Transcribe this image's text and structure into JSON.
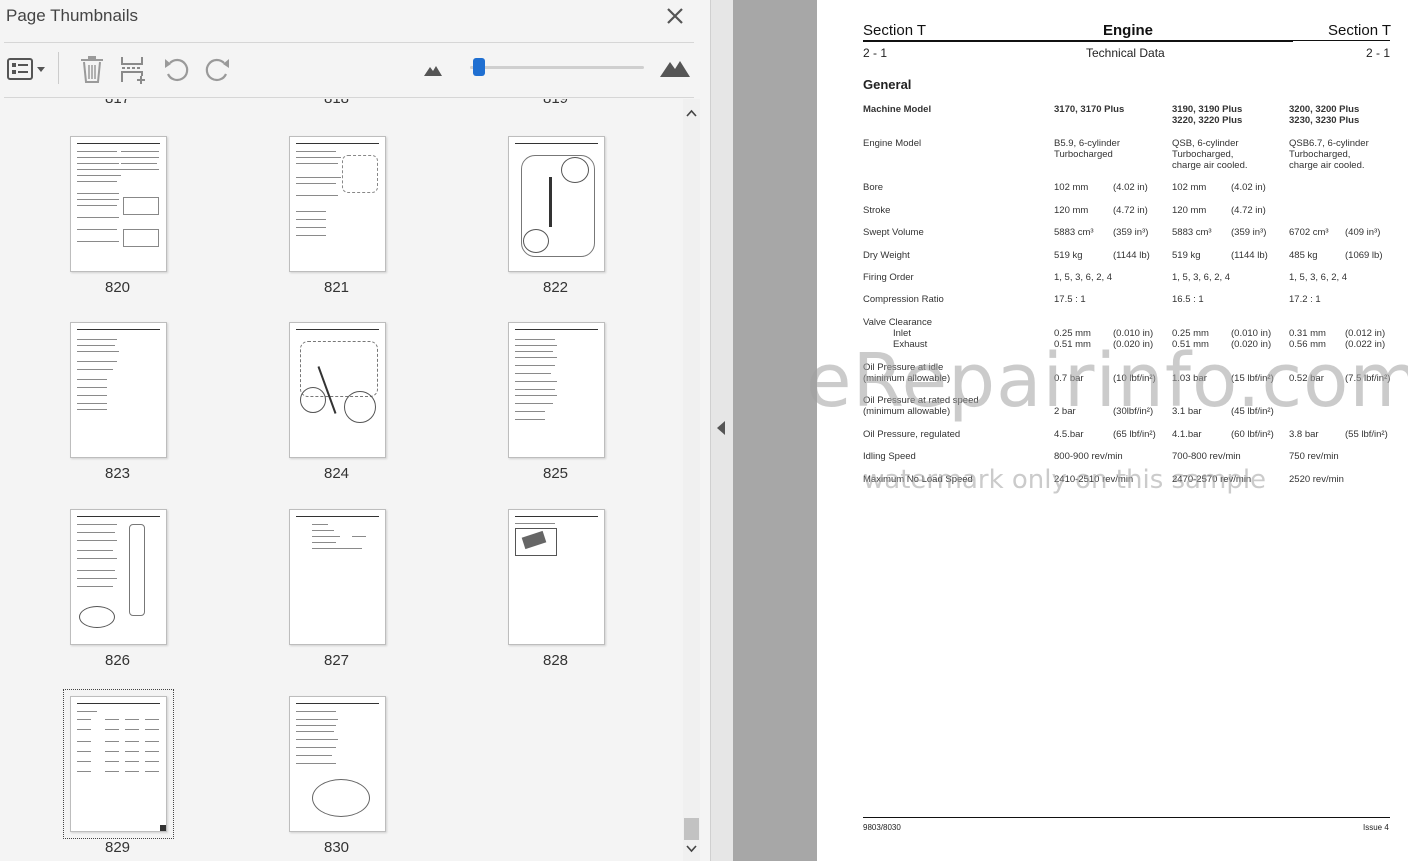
{
  "panel": {
    "title": "Page Thumbnails",
    "close_icon": "close-icon",
    "toolbar": {
      "options_icon": "thumbnail-options-icon",
      "delete_icon": "trash-icon",
      "insert_icon": "insert-pages-icon",
      "rotate_ccw_icon": "rotate-counterclockwise-icon",
      "rotate_cw_icon": "rotate-clockwise-icon",
      "zoom_out_icon": "small-mountain-icon",
      "zoom_in_icon": "large-mountain-icon",
      "zoom_level_fraction": 0.02
    }
  },
  "thumbnails": {
    "partial_numbers": [
      "817",
      "818",
      "819"
    ],
    "pages": [
      "820",
      "821",
      "822",
      "823",
      "824",
      "825",
      "826",
      "827",
      "828",
      "829",
      "830"
    ],
    "selected": "829"
  },
  "document": {
    "header": {
      "left": "Section T",
      "center": "Engine",
      "right": "Section T",
      "left_sub": "2 - 1",
      "center_sub": "Technical Data",
      "right_sub": "2 - 1"
    },
    "section_title": "General",
    "columns": {
      "label": "Machine Model",
      "c1": "3170, 3170 Plus",
      "c2a": "3190, 3190 Plus",
      "c2b": "3220, 3220 Plus",
      "c3a": "3200, 3200 Plus",
      "c3b": "3230, 3230 Plus"
    },
    "engine_model": {
      "label": "Engine Model",
      "c1a": "B5.9, 6-cylinder",
      "c1b": "Turbocharged",
      "c2a": "QSB, 6-cylinder",
      "c2b": "Turbocharged,",
      "c2c": "charge air cooled.",
      "c3a": "QSB6.7, 6-cylinder",
      "c3b": "Turbocharged,",
      "c3c": "charge air cooled."
    },
    "rows": [
      {
        "label": "Bore",
        "v1": "102 mm",
        "u1": "(4.02 in)",
        "v2": "102 mm",
        "u2": "(4.02 in)",
        "v3": "",
        "u3": ""
      },
      {
        "label": "Stroke",
        "v1": "120 mm",
        "u1": "(4.72 in)",
        "v2": "120 mm",
        "u2": "(4.72 in)",
        "v3": "",
        "u3": ""
      },
      {
        "label": "Swept Volume",
        "v1": "5883 cm³",
        "u1": "(359 in³)",
        "v2": "5883 cm³",
        "u2": "(359 in³)",
        "v3": "6702 cm³",
        "u3": "(409 in³)"
      },
      {
        "label": "Dry Weight",
        "v1": "519 kg",
        "u1": "(1144 lb)",
        "v2": "519 kg",
        "u2": "(1144 lb)",
        "v3": "485 kg",
        "u3": "(1069 lb)"
      },
      {
        "label": "Firing Order",
        "v1": "1, 5, 3, 6, 2, 4",
        "u1": "",
        "v2": "1, 5, 3, 6, 2, 4",
        "u2": "",
        "v3": "1, 5, 3, 6, 2, 4",
        "u3": ""
      },
      {
        "label": "Compression Ratio",
        "v1": "17.5 : 1",
        "u1": "",
        "v2": "16.5 : 1",
        "u2": "",
        "v3": "17.2 : 1",
        "u3": ""
      }
    ],
    "valve": {
      "label": "Valve Clearance",
      "inlet_label": "Inlet",
      "exhaust_label": "Exhaust",
      "inlet": {
        "v1": "0.25 mm",
        "u1": "(0.010 in)",
        "v2": "0.25 mm",
        "u2": "(0.010 in)",
        "v3": "0.31 mm",
        "u3": "(0.012 in)"
      },
      "exhaust": {
        "v1": "0.51 mm",
        "u1": "(0.020 in)",
        "v2": "0.51 mm",
        "u2": "(0.020 in)",
        "v3": "0.56 mm",
        "u3": "(0.022 in)"
      }
    },
    "oil_idle": {
      "label1": "Oil Pressure at idle",
      "label2": "(minimum allowable)",
      "v1": "0.7 bar",
      "u1": "(10 lbf/in²)",
      "v2": "1.03 bar",
      "u2": "(15 lbf/in²)",
      "v3": "0.52 bar",
      "u3": "(7.5 lbf/in²)"
    },
    "oil_rated": {
      "label1": "Oil Pressure at rated speed",
      "label2": "(minimum allowable)",
      "v1": "2 bar",
      "u1": "(30lbf/in²)",
      "v2": "3.1 bar",
      "u2": "(45 lbf/in²)",
      "v3": "",
      "u3": ""
    },
    "oil_reg": {
      "label": "Oil Pressure, regulated",
      "v1": "4.5.bar",
      "u1": "(65 lbf/in²)",
      "v2": "4.1.bar",
      "u2": "(60 lbf/in²)",
      "v3": "3.8 bar",
      "u3": "(55 lbf/in²)"
    },
    "idle": {
      "label": "Idling Speed",
      "v1": "800-900 rev/min",
      "v2": "700-800 rev/min",
      "v3": "750 rev/min"
    },
    "max": {
      "label": "Maximum No Load Speed",
      "v1": "2410-2510 rev/min",
      "v2": "2470-2570 rev/min",
      "v3": "2520 rev/min"
    },
    "footer": {
      "left": "9803/8030",
      "right": "Issue 4"
    }
  },
  "watermark": {
    "main": "eRepairinfo.com",
    "sub": "watermark only on this sample"
  }
}
